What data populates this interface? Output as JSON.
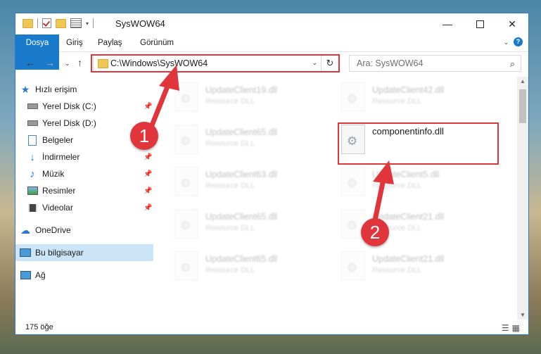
{
  "window": {
    "title": "SysWOW64",
    "minimize_icon": "minimize-icon",
    "maximize_icon": "maximize-icon",
    "close_icon": "close-icon"
  },
  "ribbon": {
    "tabs": [
      "Dosya",
      "Giriş",
      "Paylaş",
      "Görünüm"
    ]
  },
  "navigation": {
    "address": "C:\\Windows\\SysWOW64",
    "search_placeholder": "Ara: SysWOW64"
  },
  "sidebar": {
    "items": [
      {
        "label": "Hızlı erişim",
        "icon": "star-icon"
      },
      {
        "label": "Yerel Disk (C:)",
        "icon": "drive-icon"
      },
      {
        "label": "Yerel Disk (D:)",
        "icon": "drive-icon"
      },
      {
        "label": "Belgeler",
        "icon": "document-icon"
      },
      {
        "label": "İndirmeler",
        "icon": "download-icon"
      },
      {
        "label": "Müzik",
        "icon": "music-icon"
      },
      {
        "label": "Resimler",
        "icon": "pictures-icon"
      },
      {
        "label": "Videolar",
        "icon": "video-icon"
      },
      {
        "label": "OneDrive",
        "icon": "cloud-icon"
      },
      {
        "label": "Bu bilgisayar",
        "icon": "computer-icon"
      },
      {
        "label": "Ağ",
        "icon": "network-icon"
      }
    ]
  },
  "files": [
    {
      "name": "UpdateClient19.dll",
      "type": "Resource DLL"
    },
    {
      "name": "UpdateClient42.dll",
      "type": "Resource DLL"
    },
    {
      "name": "UpdateClient65.dll",
      "type": "Resource DLL"
    },
    {
      "name": "componentinfo.dll",
      "type": ""
    },
    {
      "name": "UpdateClient63.dll",
      "type": "Resource DLL"
    },
    {
      "name": "UpdateClient5.dll",
      "type": "Resource DLL"
    },
    {
      "name": "UpdateClient65.dll",
      "type": "Resource DLL"
    },
    {
      "name": "UpdateClient21.dll",
      "type": "Resource DLL"
    },
    {
      "name": "UpdateClient65.dll",
      "type": "Resource DLL"
    },
    {
      "name": "UpdateClient21.dll",
      "type": "Resource DLL"
    }
  ],
  "status": {
    "item_count": "175 öğe"
  },
  "annotations": {
    "badge1": "1",
    "badge2": "2",
    "accent_color": "#e0353a"
  }
}
